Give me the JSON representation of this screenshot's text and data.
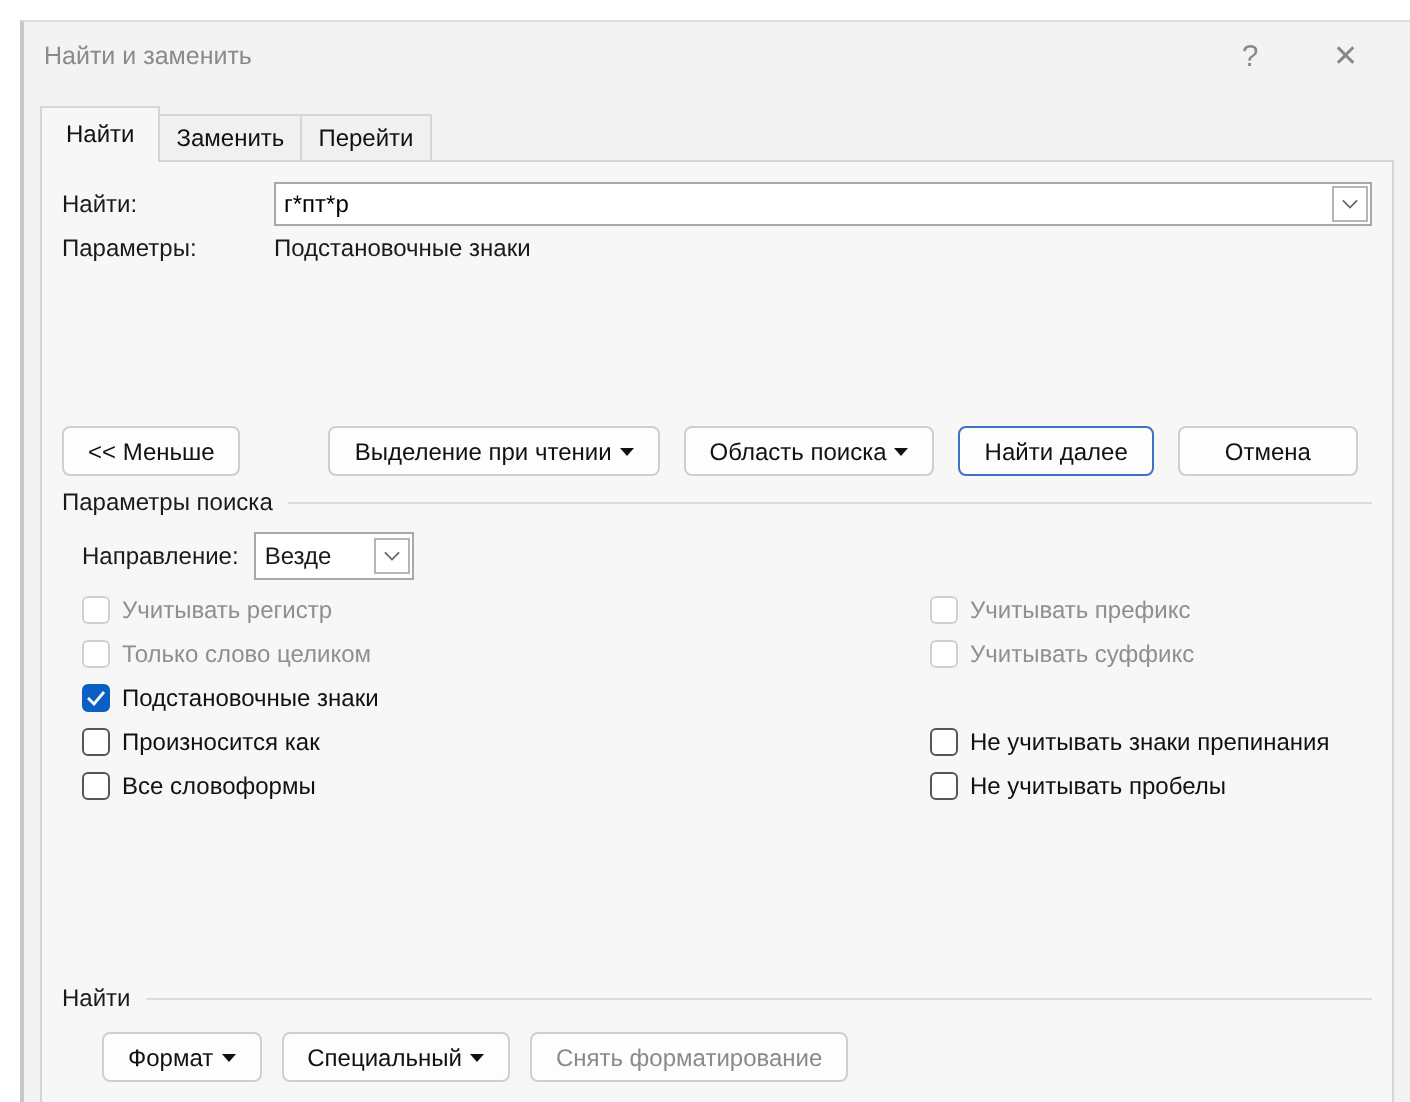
{
  "window": {
    "title": "Найти и заменить",
    "help": "?",
    "close": "✕"
  },
  "tabs": [
    {
      "label": "Найти",
      "selected": true
    },
    {
      "label": "Заменить",
      "selected": false
    },
    {
      "label": "Перейти",
      "selected": false
    }
  ],
  "find": {
    "label": "Найти:",
    "value": "г*пт*р"
  },
  "params": {
    "label": "Параметры:",
    "value": "Подстановочные знаки"
  },
  "buttons": [
    {
      "label": "<< Меньше",
      "dropdown": false,
      "default": false
    },
    {
      "label": "Выделение при чтении",
      "dropdown": true,
      "default": false
    },
    {
      "label": "Область поиска",
      "dropdown": true,
      "default": false
    },
    {
      "label": "Найти далее",
      "dropdown": false,
      "default": true
    },
    {
      "label": "Отмена",
      "dropdown": false,
      "default": false
    }
  ],
  "search_options": {
    "title": "Параметры поиска",
    "direction_label": "Направление:",
    "direction_value": "Везде",
    "left": [
      {
        "label": "Учитывать регистр",
        "checked": false,
        "disabled": true
      },
      {
        "label": "Только слово целиком",
        "checked": false,
        "disabled": true
      },
      {
        "label": "Подстановочные знаки",
        "checked": true,
        "disabled": false
      },
      {
        "label": "Произносится как",
        "checked": false,
        "disabled": false
      },
      {
        "label": "Все словоформы",
        "checked": false,
        "disabled": false
      }
    ],
    "right": [
      {
        "label": "Учитывать префикс",
        "checked": false,
        "disabled": true
      },
      {
        "label": "Учитывать суффикс",
        "checked": false,
        "disabled": true
      },
      {
        "label": "Не учитывать знаки препинания",
        "checked": false,
        "disabled": false
      },
      {
        "label": "Не учитывать пробелы",
        "checked": false,
        "disabled": false
      }
    ]
  },
  "find_section": {
    "title": "Найти",
    "buttons": [
      {
        "label": "Формат",
        "dropdown": true,
        "disabled": false
      },
      {
        "label": "Специальный",
        "dropdown": true,
        "disabled": false
      },
      {
        "label": "Снять форматирование",
        "dropdown": false,
        "disabled": true
      }
    ]
  }
}
